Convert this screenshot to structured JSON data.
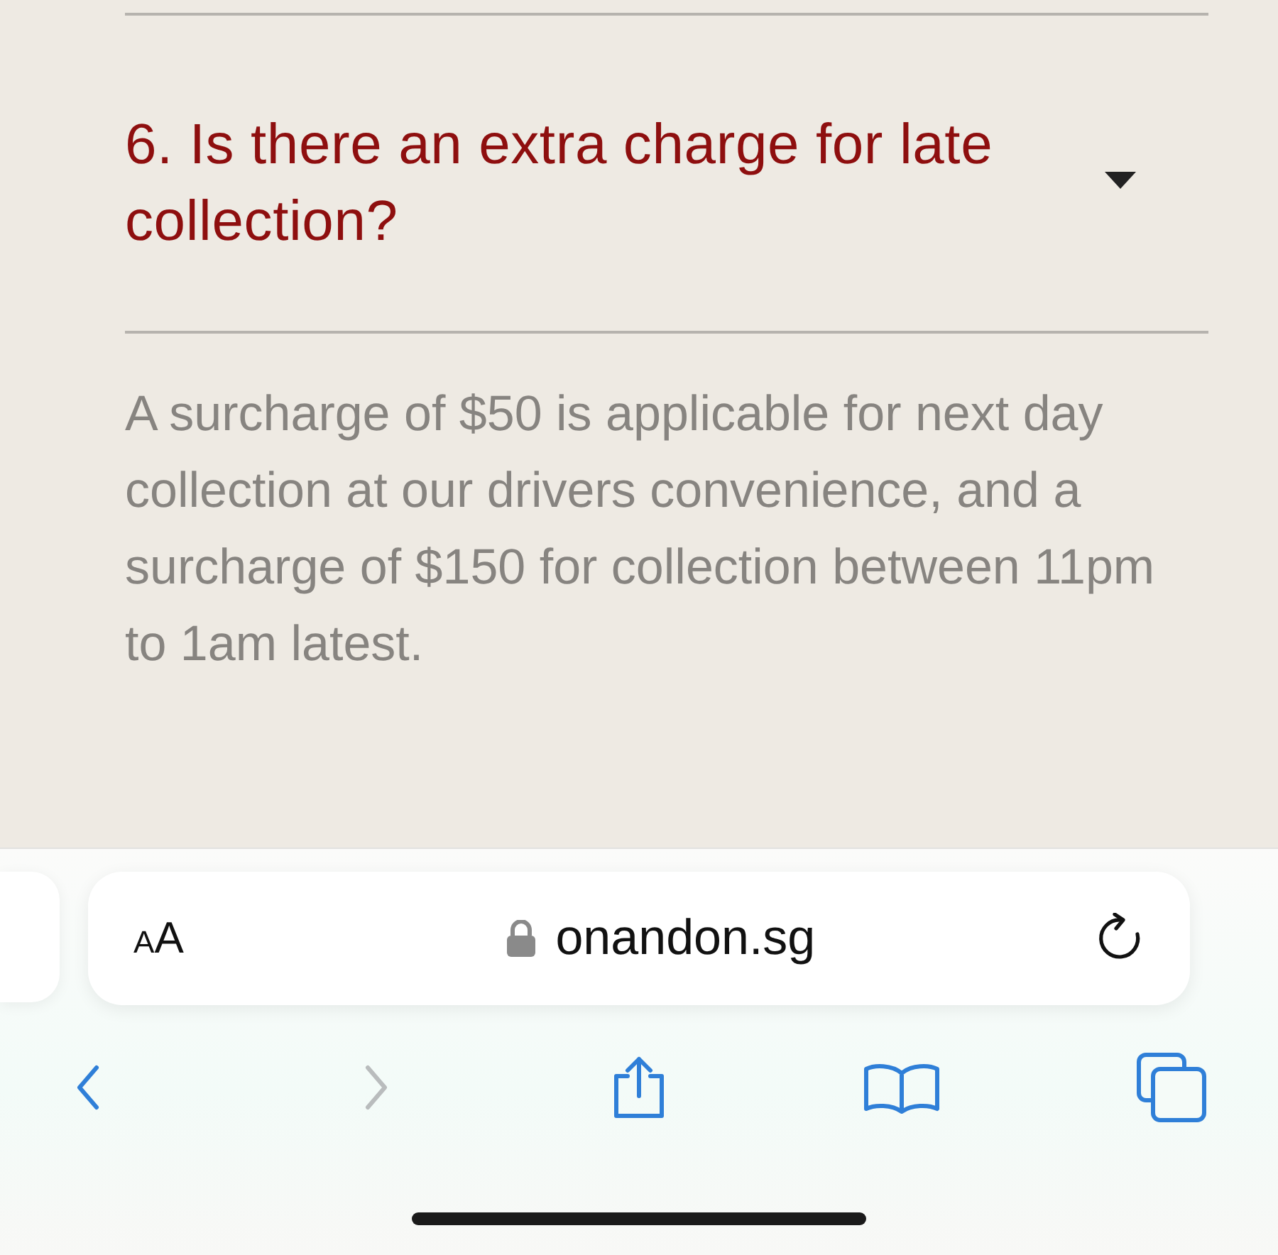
{
  "faq_item": {
    "question": "6. Is there an extra charge for late collection?",
    "answer": "A surcharge of $50 is applicable for next day collection at our drivers convenience, and a surcharge of $150 for collection between 11pm to 1am latest."
  },
  "address_bar": {
    "text_size_small": "A",
    "text_size_large": "A",
    "secure": true,
    "url": "onandon.sg"
  },
  "toolbar": [
    {
      "kind": "back",
      "disabled": false
    },
    {
      "kind": "forward",
      "disabled": true
    },
    {
      "kind": "share",
      "disabled": false
    },
    {
      "kind": "bookmarks",
      "disabled": false
    },
    {
      "kind": "tabs",
      "disabled": false
    }
  ]
}
